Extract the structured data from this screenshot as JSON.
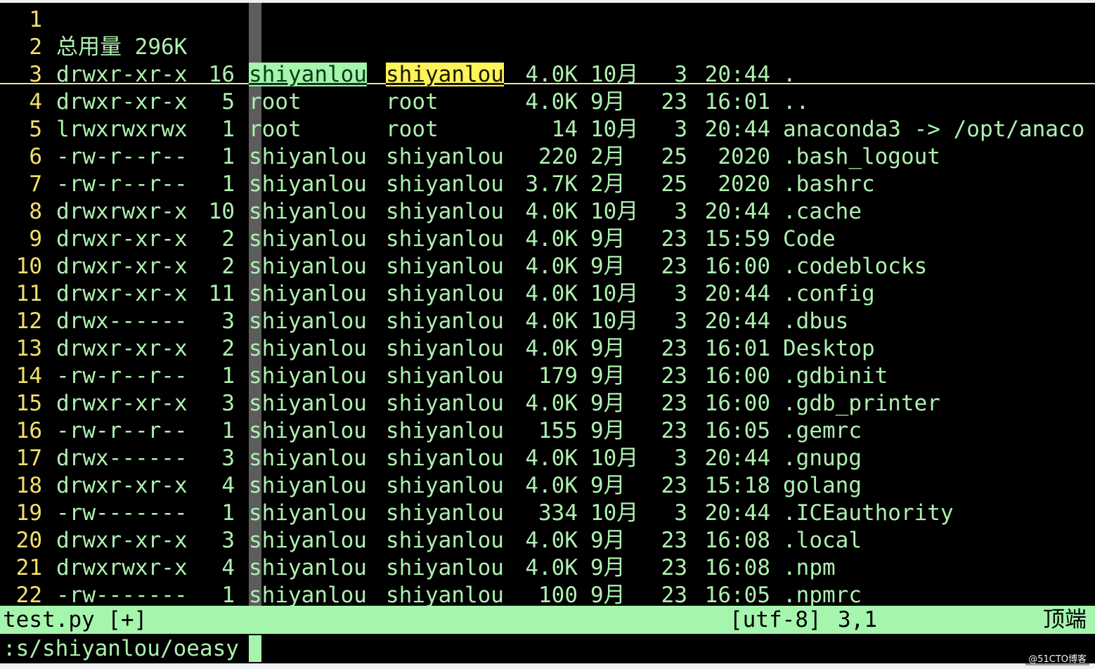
{
  "editor": {
    "lines": [
      {
        "num": "1",
        "perm": "",
        "links": "",
        "owner": "",
        "group": "",
        "size": "",
        "month": "",
        "day": "",
        "time": "",
        "name": ""
      },
      {
        "num": "2",
        "perm": "总用量 296K",
        "links": "",
        "owner": "",
        "group": "",
        "size": "",
        "month": "",
        "day": "",
        "time": "",
        "name": ""
      },
      {
        "num": "3",
        "perm": "drwxr-xr-x",
        "links": "16",
        "owner": "shiyanlou",
        "group": "shiyanlou",
        "size": "4.0K",
        "month": "10月",
        "day": "3",
        "time": "20:44",
        "name": "."
      },
      {
        "num": "4",
        "perm": "drwxr-xr-x",
        "links": "5",
        "owner": "root",
        "group": "root",
        "size": "4.0K",
        "month": "9月",
        "day": "23",
        "time": "16:01",
        "name": ".."
      },
      {
        "num": "5",
        "perm": "lrwxrwxrwx",
        "links": "1",
        "owner": "root",
        "group": "root",
        "size": "14",
        "month": "10月",
        "day": "3",
        "time": "20:44",
        "name": "anaconda3 -> /opt/anaco"
      },
      {
        "num": "6",
        "perm": "-rw-r--r--",
        "links": "1",
        "owner": "shiyanlou",
        "group": "shiyanlou",
        "size": "220",
        "month": "2月",
        "day": "25",
        "time": "2020",
        "name": ".bash_logout"
      },
      {
        "num": "7",
        "perm": "-rw-r--r--",
        "links": "1",
        "owner": "shiyanlou",
        "group": "shiyanlou",
        "size": "3.7K",
        "month": "2月",
        "day": "25",
        "time": "2020",
        "name": ".bashrc"
      },
      {
        "num": "8",
        "perm": "drwxrwxr-x",
        "links": "10",
        "owner": "shiyanlou",
        "group": "shiyanlou",
        "size": "4.0K",
        "month": "10月",
        "day": "3",
        "time": "20:44",
        "name": ".cache"
      },
      {
        "num": "9",
        "perm": "drwxr-xr-x",
        "links": "2",
        "owner": "shiyanlou",
        "group": "shiyanlou",
        "size": "4.0K",
        "month": "9月",
        "day": "23",
        "time": "15:59",
        "name": "Code"
      },
      {
        "num": "10",
        "perm": "drwxr-xr-x",
        "links": "2",
        "owner": "shiyanlou",
        "group": "shiyanlou",
        "size": "4.0K",
        "month": "9月",
        "day": "23",
        "time": "16:00",
        "name": ".codeblocks"
      },
      {
        "num": "11",
        "perm": "drwxr-xr-x",
        "links": "11",
        "owner": "shiyanlou",
        "group": "shiyanlou",
        "size": "4.0K",
        "month": "10月",
        "day": "3",
        "time": "20:44",
        "name": ".config"
      },
      {
        "num": "12",
        "perm": "drwx------",
        "links": "3",
        "owner": "shiyanlou",
        "group": "shiyanlou",
        "size": "4.0K",
        "month": "10月",
        "day": "3",
        "time": "20:44",
        "name": ".dbus"
      },
      {
        "num": "13",
        "perm": "drwxr-xr-x",
        "links": "2",
        "owner": "shiyanlou",
        "group": "shiyanlou",
        "size": "4.0K",
        "month": "9月",
        "day": "23",
        "time": "16:01",
        "name": "Desktop"
      },
      {
        "num": "14",
        "perm": "-rw-r--r--",
        "links": "1",
        "owner": "shiyanlou",
        "group": "shiyanlou",
        "size": "179",
        "month": "9月",
        "day": "23",
        "time": "16:00",
        "name": ".gdbinit"
      },
      {
        "num": "15",
        "perm": "drwxr-xr-x",
        "links": "3",
        "owner": "shiyanlou",
        "group": "shiyanlou",
        "size": "4.0K",
        "month": "9月",
        "day": "23",
        "time": "16:00",
        "name": ".gdb_printer"
      },
      {
        "num": "16",
        "perm": "-rw-r--r--",
        "links": "1",
        "owner": "shiyanlou",
        "group": "shiyanlou",
        "size": "155",
        "month": "9月",
        "day": "23",
        "time": "16:05",
        "name": ".gemrc"
      },
      {
        "num": "17",
        "perm": "drwx------",
        "links": "3",
        "owner": "shiyanlou",
        "group": "shiyanlou",
        "size": "4.0K",
        "month": "10月",
        "day": "3",
        "time": "20:44",
        "name": ".gnupg"
      },
      {
        "num": "18",
        "perm": "drwxr-xr-x",
        "links": "4",
        "owner": "shiyanlou",
        "group": "shiyanlou",
        "size": "4.0K",
        "month": "9月",
        "day": "23",
        "time": "15:18",
        "name": "golang"
      },
      {
        "num": "19",
        "perm": "-rw-------",
        "links": "1",
        "owner": "shiyanlou",
        "group": "shiyanlou",
        "size": "334",
        "month": "10月",
        "day": "3",
        "time": "20:44",
        "name": ".ICEauthority"
      },
      {
        "num": "20",
        "perm": "drwxr-xr-x",
        "links": "3",
        "owner": "shiyanlou",
        "group": "shiyanlou",
        "size": "4.0K",
        "month": "9月",
        "day": "23",
        "time": "16:08",
        "name": ".local"
      },
      {
        "num": "21",
        "perm": "drwxrwxr-x",
        "links": "4",
        "owner": "shiyanlou",
        "group": "shiyanlou",
        "size": "4.0K",
        "month": "9月",
        "day": "23",
        "time": "16:08",
        "name": ".npm"
      },
      {
        "num": "22",
        "perm": "-rw-------",
        "links": "1",
        "owner": "shiyanlou",
        "group": "shiyanlou",
        "size": "100",
        "month": "9月",
        "day": "23",
        "time": "16:05",
        "name": ".npmrc"
      }
    ]
  },
  "statusline": {
    "filename": "test.py [+]",
    "encoding": "[utf-8]",
    "position": "3,1",
    "scroll": "顶端"
  },
  "cmdline": {
    "command": ":s/shiyanlou/oeasy"
  },
  "watermark": "@51CTO博客",
  "colors": {
    "background": "#000000",
    "text": "#aef0b0",
    "line_number": "#f2e06a",
    "search_highlight": "#a5f5ad",
    "current_match": "#fff35a",
    "statusline_bg": "#a5f5ad"
  }
}
